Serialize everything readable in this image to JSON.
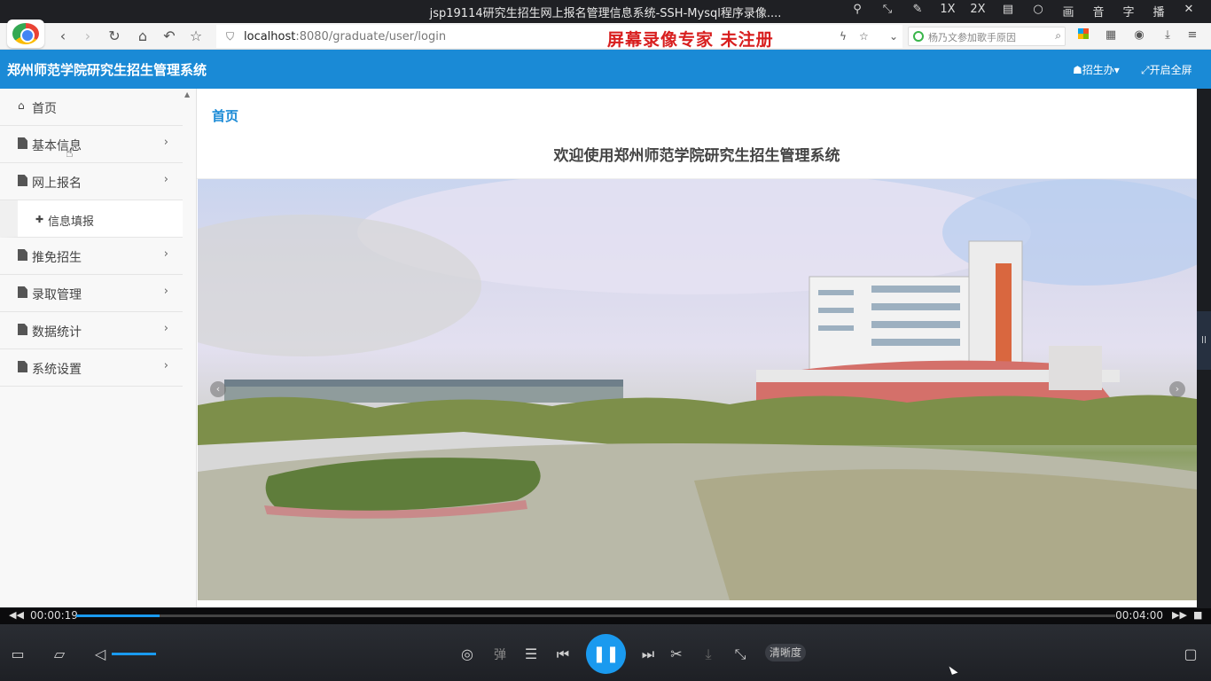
{
  "player": {
    "title": "jsp19114研究生招生网上报名管理信息系统-SSH-Mysql程序录像....",
    "controls": [
      "pin-icon",
      "shrink-icon",
      "edit-icon",
      "1X",
      "2X",
      "layout-icon",
      "bulb-icon",
      "画",
      "音",
      "字",
      "播",
      "close-icon"
    ],
    "time_current": "00:00:19",
    "time_total": "00:04:00",
    "progress_fraction": 0.08,
    "volume_fraction": 1.0,
    "danmaku_label": "弹",
    "quality_label": "清晰度"
  },
  "browser": {
    "url_host": "localhost",
    "url_path": ":8080/graduate/user/login",
    "watermark": "屏幕录像专家  未注册",
    "search_placeholder": "杨乃文参加歌手原因"
  },
  "app": {
    "system_title": "郑州师范学院研究生招生管理系统",
    "user_menu": "招生办",
    "fullscreen_label": "开启全屏"
  },
  "sidebar": {
    "items": [
      {
        "label": "首页",
        "icon": "home-icon",
        "has_children": false
      },
      {
        "label": "基本信息",
        "icon": "file-icon",
        "has_children": true
      },
      {
        "label": "网上报名",
        "icon": "file-icon",
        "has_children": true
      },
      {
        "label": "信息填报",
        "icon": "puzzle-icon",
        "sub": true
      },
      {
        "label": "推免招生",
        "icon": "file-icon",
        "has_children": true
      },
      {
        "label": "录取管理",
        "icon": "file-icon",
        "has_children": true
      },
      {
        "label": "数据统计",
        "icon": "file-icon",
        "has_children": true
      },
      {
        "label": "系统设置",
        "icon": "file-icon",
        "has_children": true
      }
    ]
  },
  "main": {
    "breadcrumb": "首页",
    "welcome": "欢迎使用郑州师范学院研究生招生管理系统"
  },
  "right_tab_label": "||"
}
